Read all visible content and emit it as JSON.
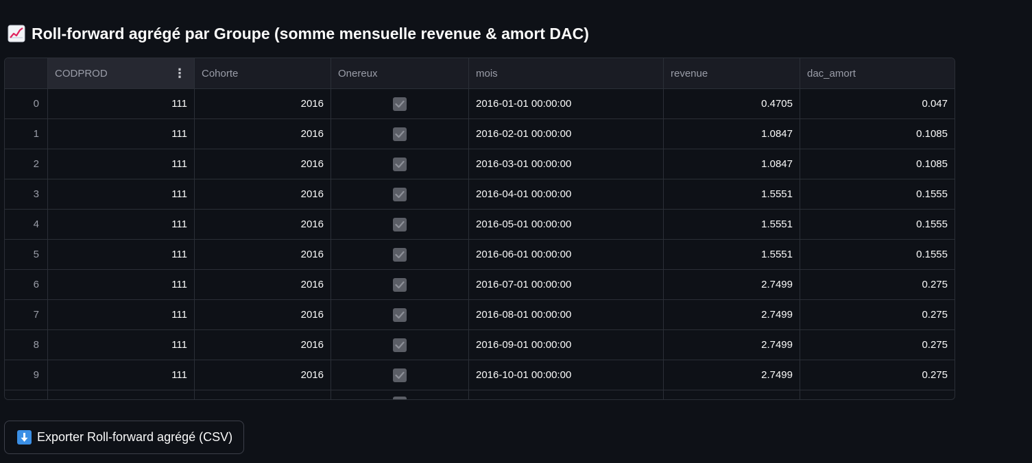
{
  "title": "Roll-forward agrégé par Groupe (somme mensuelle revenue & amort DAC)",
  "title_icon": "chart-increasing-icon",
  "table": {
    "columns": [
      "",
      "CODPROD",
      "Cohorte",
      "Onereux",
      "mois",
      "revenue",
      "dac_amort"
    ],
    "rows": [
      {
        "index": "0",
        "codprod": "111",
        "cohorte": "2016",
        "onereux": true,
        "mois": "2016-01-01 00:00:00",
        "revenue": "0.4705",
        "dac_amort": "0.047"
      },
      {
        "index": "1",
        "codprod": "111",
        "cohorte": "2016",
        "onereux": true,
        "mois": "2016-02-01 00:00:00",
        "revenue": "1.0847",
        "dac_amort": "0.1085"
      },
      {
        "index": "2",
        "codprod": "111",
        "cohorte": "2016",
        "onereux": true,
        "mois": "2016-03-01 00:00:00",
        "revenue": "1.0847",
        "dac_amort": "0.1085"
      },
      {
        "index": "3",
        "codprod": "111",
        "cohorte": "2016",
        "onereux": true,
        "mois": "2016-04-01 00:00:00",
        "revenue": "1.5551",
        "dac_amort": "0.1555"
      },
      {
        "index": "4",
        "codprod": "111",
        "cohorte": "2016",
        "onereux": true,
        "mois": "2016-05-01 00:00:00",
        "revenue": "1.5551",
        "dac_amort": "0.1555"
      },
      {
        "index": "5",
        "codprod": "111",
        "cohorte": "2016",
        "onereux": true,
        "mois": "2016-06-01 00:00:00",
        "revenue": "1.5551",
        "dac_amort": "0.1555"
      },
      {
        "index": "6",
        "codprod": "111",
        "cohorte": "2016",
        "onereux": true,
        "mois": "2016-07-01 00:00:00",
        "revenue": "2.7499",
        "dac_amort": "0.275"
      },
      {
        "index": "7",
        "codprod": "111",
        "cohorte": "2016",
        "onereux": true,
        "mois": "2016-08-01 00:00:00",
        "revenue": "2.7499",
        "dac_amort": "0.275"
      },
      {
        "index": "8",
        "codprod": "111",
        "cohorte": "2016",
        "onereux": true,
        "mois": "2016-09-01 00:00:00",
        "revenue": "2.7499",
        "dac_amort": "0.275"
      },
      {
        "index": "9",
        "codprod": "111",
        "cohorte": "2016",
        "onereux": true,
        "mois": "2016-10-01 00:00:00",
        "revenue": "2.7499",
        "dac_amort": "0.275"
      }
    ]
  },
  "export_button": {
    "label": "Exporter Roll-forward agrégé (CSV)",
    "icon": "down-arrow-icon"
  },
  "colors": {
    "background": "#0e1117",
    "header_background": "#1a1c24",
    "checkbox": "#5b5e66",
    "download_icon": "#3b8fe5"
  }
}
